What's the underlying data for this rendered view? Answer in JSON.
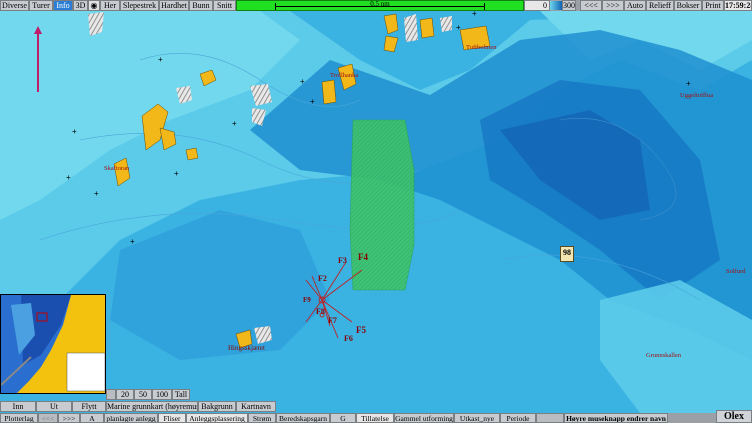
{
  "top_menu": [
    "Diverse",
    "Turer",
    "Info",
    "3D",
    "",
    "Her",
    "Slepestrek",
    "Hardhet",
    "Bunn",
    "Snitt"
  ],
  "scale": {
    "label": "0,5 nm"
  },
  "depth_counter": {
    "zero": "0",
    "max": "300"
  },
  "top_right": {
    "prev": "<<<",
    "next": ">>>",
    "auto": "Auto",
    "relieff": "Relieff",
    "bokser": "Bokser",
    "print": "Print",
    "time": "17:59:28"
  },
  "map": {
    "place_names": [
      "Uggeltofflua",
      "Hingsskjæret",
      "Grunnskallen",
      "Solfurd",
      "Skaftoran",
      "Tuftholmen",
      "Trollhanka"
    ],
    "marker_98": "98",
    "features": [
      "F4",
      "F3",
      "F2",
      "F5",
      "F6",
      "F8",
      "F7",
      "F9"
    ]
  },
  "zoom_panel": {
    "inn": "Inn",
    "ut": "Ut",
    "flytt": "Flytt",
    "levels": [
      "20",
      "50",
      "100",
      "Tall"
    ]
  },
  "mid_toolbar": [
    "Marine grunnkart (høyremus)",
    "Bakgrunn",
    "Kartnavn"
  ],
  "bottom_toolbar": [
    "Plotterlag",
    "<<<",
    ">>>",
    "A",
    "planlagte anlegg",
    "Fliser",
    "Anleggsplassering",
    "Strøm",
    "Beredskapsgarn",
    "G",
    "Tillatelse",
    "Gammel utforming",
    "Utkast_nye",
    "Periode",
    "",
    "Høyre museknapp endrer navn"
  ],
  "brand": "Olex",
  "colors": {
    "deep": "#1a8fd0",
    "shallow": "#6dd6ec",
    "land": "#f2b81a",
    "zone": "#3fc46a",
    "accent": "#21e021"
  }
}
